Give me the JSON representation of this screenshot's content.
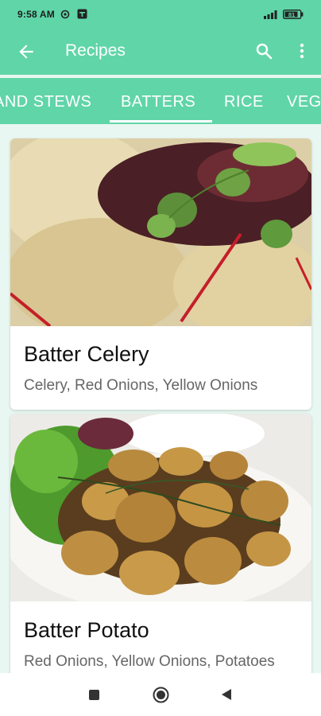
{
  "status_bar": {
    "time": "9:58 AM",
    "left_icons": [
      "settings-icon",
      "notification-icon"
    ],
    "right_icons": [
      "signal-icon",
      "battery-icon"
    ],
    "battery": "81"
  },
  "app_bar": {
    "title": "Recipes",
    "icons": [
      "back-arrow-icon",
      "search-icon",
      "more-vert-icon"
    ]
  },
  "tabs": {
    "items": [
      {
        "label": "AND STEWS",
        "selected": false
      },
      {
        "label": "BATTERS",
        "selected": true
      },
      {
        "label": "RICE",
        "selected": false
      },
      {
        "label": "VEG",
        "selected": false
      }
    ]
  },
  "recipes": [
    {
      "title": "Batter Celery",
      "ingredients": "Celery, Red Onions, Yellow Onions"
    },
    {
      "title": "Batter Potato",
      "ingredients": "Red Onions, Yellow Onions, Potatoes"
    }
  ],
  "nav_bar": {
    "icons": [
      "recents-square-icon",
      "home-circle-icon",
      "back-triangle-icon"
    ]
  },
  "colors": {
    "accent": "#60d5a8",
    "background": "#e8f7f1"
  }
}
